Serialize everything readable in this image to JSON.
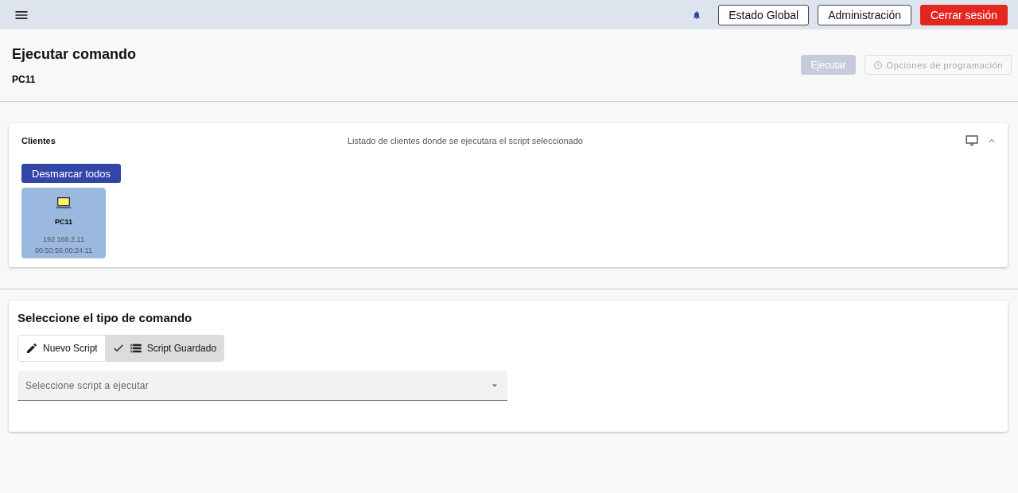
{
  "top_bar": {
    "buttons": [
      {
        "label": "Estado Global",
        "kind": "outline"
      },
      {
        "label": "Administración",
        "kind": "outline"
      },
      {
        "label": "Cerrar sesión",
        "kind": "danger"
      }
    ]
  },
  "page": {
    "title": "Ejecutar comando",
    "subtitle": "PC11",
    "actions": [
      {
        "label": "Ejecutar",
        "kind": "flat",
        "disabled": true
      },
      {
        "label": "Opciones de programación",
        "kind": "clock",
        "disabled": true
      }
    ]
  },
  "clients_panel": {
    "title": "Clientes",
    "description": "Listado de clientes donde se ejecutara el script seleccionado",
    "expanded": true,
    "button": "Desmarcar todos",
    "clients": [
      {
        "name": "PC11",
        "ip": "192.168.2.11",
        "mac": "00:50:56:00:24:11",
        "selected": true
      }
    ]
  },
  "command_panel": {
    "title": "Seleccione el tipo de comando",
    "options": [
      {
        "label": "Nuevo Script",
        "kind": "pencil",
        "selected": false
      },
      {
        "label": "Script Guardado",
        "kind": "list",
        "selected": true
      }
    ],
    "select": {
      "placeholder": "Seleccione script a ejecutar"
    }
  }
}
